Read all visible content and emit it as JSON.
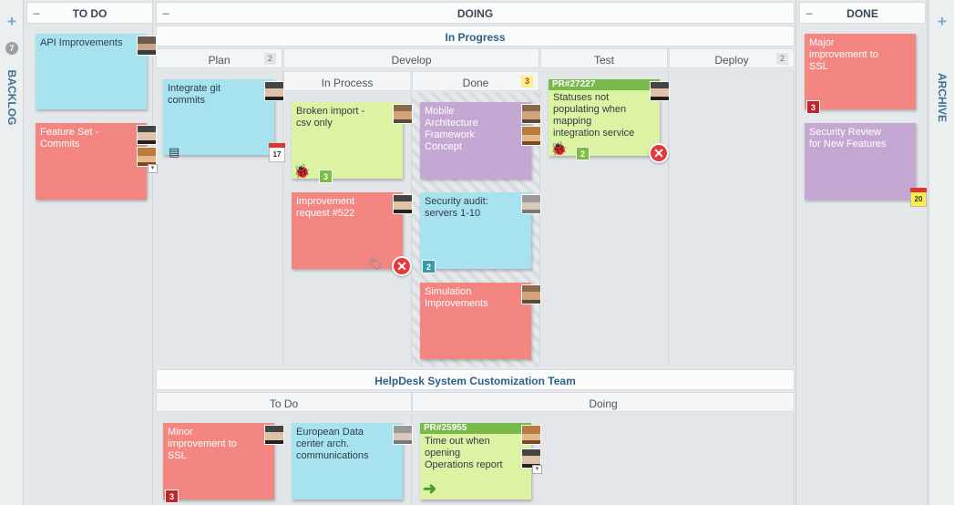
{
  "rails": {
    "backlog": {
      "label": "BACKLOG",
      "count": "7"
    },
    "archive": {
      "label": "ARCHIVE"
    }
  },
  "lanes": {
    "todo": {
      "title": "TO DO"
    },
    "doing": {
      "title": "DOING"
    },
    "done": {
      "title": "DONE"
    }
  },
  "in_progress": {
    "title": "In Progress",
    "plan": {
      "title": "Plan",
      "wip": "2"
    },
    "develop": {
      "title": "Develop",
      "in_process": "In Process",
      "done": "Done",
      "done_wip": "3"
    },
    "test": {
      "title": "Test"
    },
    "deploy": {
      "title": "Deploy",
      "wip": "2"
    }
  },
  "helpdesk": {
    "title": "HelpDesk System Customization Team",
    "todo": "To Do",
    "doing": "Doing"
  },
  "cards": {
    "api": "API Improvements",
    "feature_set": "Feature Set - Commits",
    "integrate_git": "Integrate git commits",
    "integrate_git_date": "17",
    "broken_import": "Broken import - csv only",
    "broken_import_badge": "3",
    "improvement_522": "Improvement request #522",
    "mobile_arch": "Mobile Architecture Framework Concept",
    "security_audit": "Security audit: servers 1-10",
    "security_audit_badge": "2",
    "simulation": "Simulation Improvements",
    "pr27227_tag": "PR#27227",
    "pr27227_text": "Statuses not populating when mapping integration service",
    "pr27227_badge": "2",
    "major_ssl": "Major improvement to SSL",
    "major_ssl_badge": "3",
    "security_review": "Security Review for New Features",
    "security_review_date": "20",
    "minor_ssl": "Minor improvement to SSL",
    "minor_ssl_badge": "3",
    "european": "European Data center arch. communications",
    "pr25955_tag": "PR#25955",
    "pr25955_text": "Time out when opening Operations report"
  },
  "icons": {
    "plus": "+",
    "minus": "−",
    "blocked": "✕",
    "bug": "🐞",
    "arrow": "➜"
  },
  "colors": {
    "card_green": "#dcf3a3",
    "card_cyan": "#a7e3ee",
    "card_red": "#f48682",
    "card_purple": "#c5a7d4",
    "header_blue": "#2d5f88"
  }
}
